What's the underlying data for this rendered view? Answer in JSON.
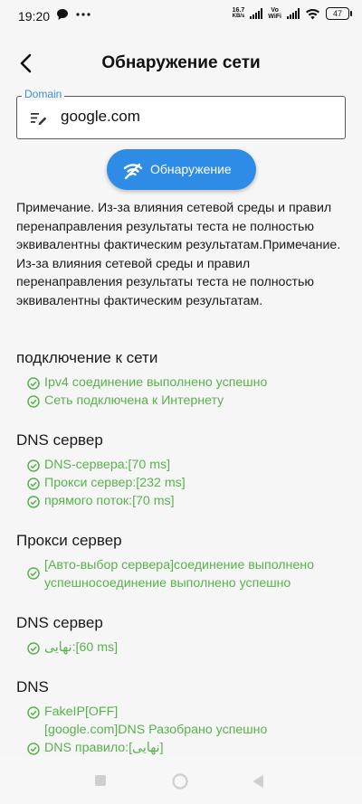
{
  "status_bar": {
    "time": "19:20",
    "net_speed_value": "16.7",
    "net_speed_unit": "KB/s",
    "vo_label": "Vo",
    "wifi_label": "WiFi",
    "battery": "47"
  },
  "header": {
    "title": "Обнаружение сети"
  },
  "domain_field": {
    "label": "Domain",
    "value": "google.com"
  },
  "detect_button": {
    "label": "Обнаружение"
  },
  "note": "Примечание. Из-за влияния сетевой среды и правил перенаправления результаты теста не полностью эквивалентны фактическим результатам.Примечание. Из-за влияния сетевой среды и правил перенаправления результаты теста не полностью эквивалентны фактическим результатам.",
  "sections": [
    {
      "title": "подключение к сети",
      "items": [
        "Ipv4 соединение выполнено успешно",
        "Сеть подключена к Интернету"
      ]
    },
    {
      "title": "DNS сервер",
      "items": [
        "DNS-сервера:[70 ms]",
        "Прокси сервер:[232 ms]",
        "прямого поток:[70 ms]"
      ]
    },
    {
      "title": "Прокси сервер",
      "items": [
        "[Авто-выбор сервера]соединение выполнено",
        "успешносоединение выполнено успешно"
      ]
    },
    {
      "title": "DNS сервер",
      "items": [
        "نهایی:[60 ms]"
      ]
    },
    {
      "title": "DNS",
      "items": [
        "FakeIP[OFF]",
        "[google.com]DNS Разобрано успешно",
        "DNS правило:[نهایی]"
      ]
    }
  ],
  "colors": {
    "accent": "#2f8ce6",
    "success": "#58b24c",
    "label": "#3d8fd8"
  },
  "icons": [
    "back-arrow-icon",
    "edit-list-icon",
    "wifi-scan-icon",
    "check-circle-icon",
    "square-nav-icon",
    "circle-nav-icon",
    "triangle-nav-icon"
  ]
}
